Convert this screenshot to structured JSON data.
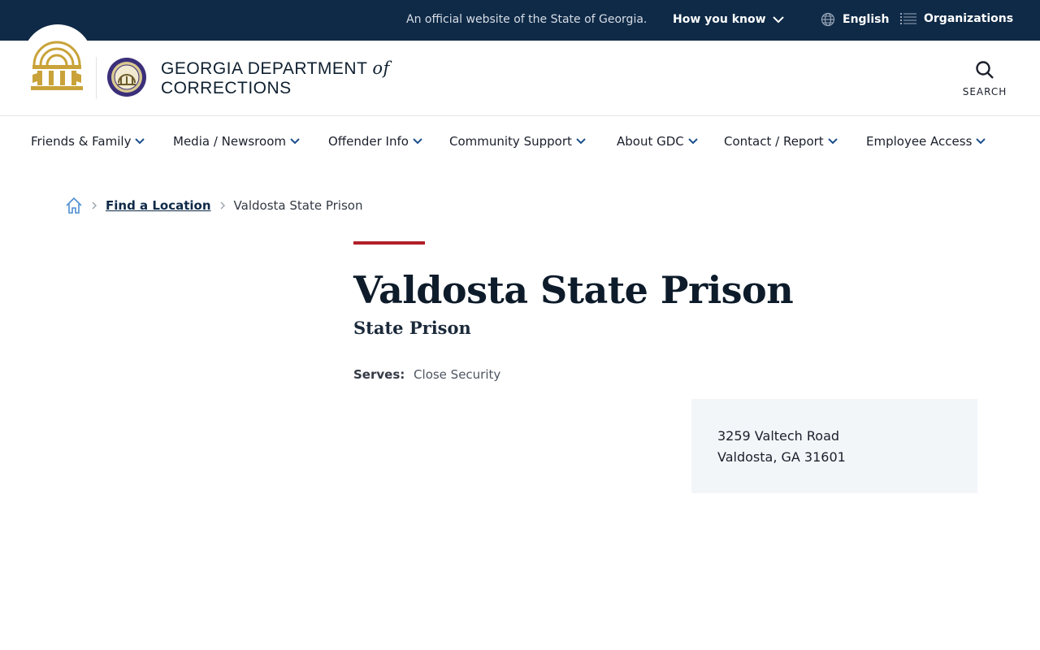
{
  "topbar": {
    "official_text": "An official website of the State of Georgia.",
    "how_you_know": "How you know",
    "language": "English",
    "organizations": "Organizations"
  },
  "header": {
    "title_line1_main": "GEORGIA DEPARTMENT",
    "title_line1_of": "of",
    "title_line2": "CORRECTIONS",
    "search_label": "SEARCH"
  },
  "nav": {
    "items": [
      {
        "label": "Friends & Family"
      },
      {
        "label": "Media / Newsroom"
      },
      {
        "label": "Offender Info"
      },
      {
        "label": "Community Support"
      },
      {
        "label": "About GDC"
      },
      {
        "label": "Contact / Report"
      },
      {
        "label": "Employee Access"
      }
    ]
  },
  "breadcrumb": {
    "link": "Find a Location",
    "current": "Valdosta State Prison"
  },
  "main": {
    "title": "Valdosta State Prison",
    "subtitle": "State Prison",
    "serves_label": "Serves:",
    "serves_value": "Close Security",
    "address_line1": "3259 Valtech Road",
    "address_line2": "Valdosta, GA 31601"
  },
  "colors": {
    "topbar_bg": "#0f2a47",
    "accent_red": "#b0202a",
    "logo_gold": "#c9a33a",
    "seal_purple": "#3b2f7a",
    "address_bg": "#f3f6f9"
  }
}
